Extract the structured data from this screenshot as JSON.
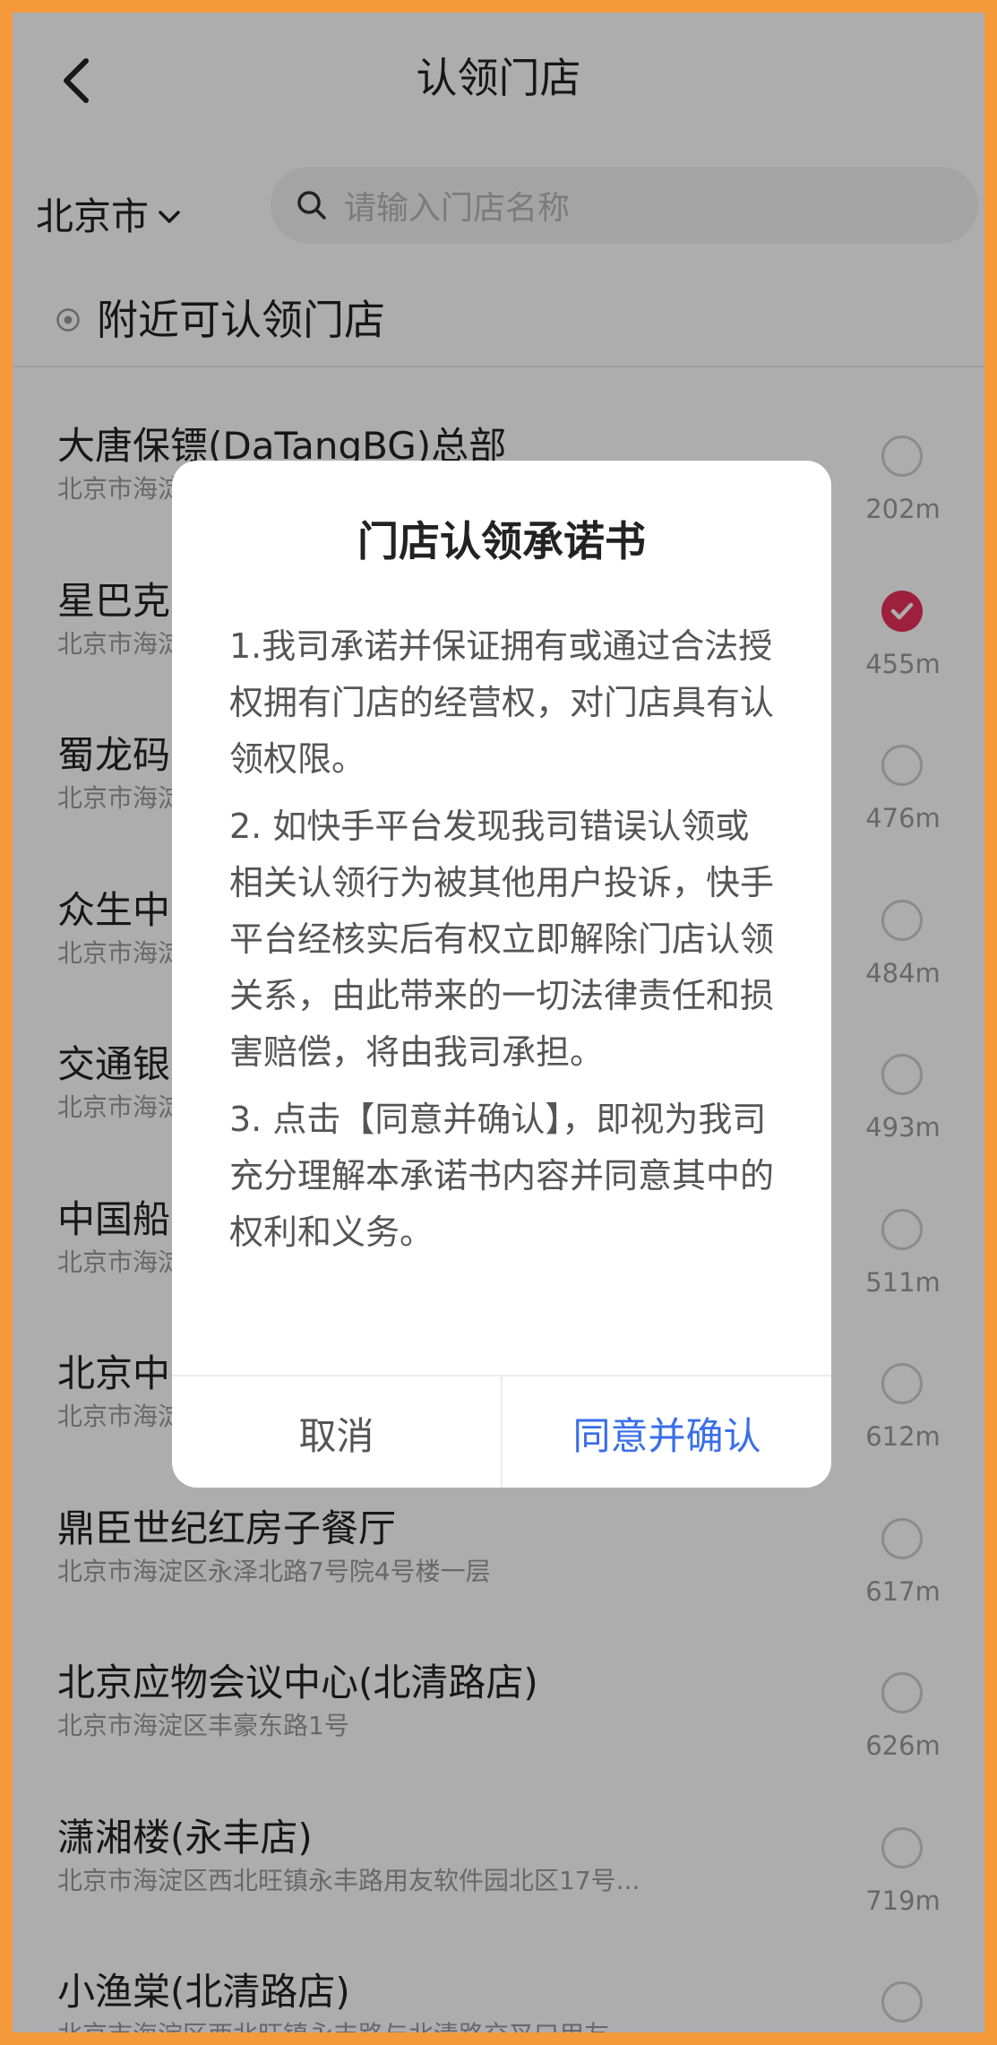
{
  "header": {
    "title": "认领门店"
  },
  "filter": {
    "city": "北京市",
    "search_placeholder": "请输入门店名称"
  },
  "section": {
    "title": "附近可认领门店"
  },
  "stores": [
    {
      "name": "大唐保镖(DaTangBG)总部",
      "address": "北京市海淀区",
      "distance": "202m",
      "selected": false
    },
    {
      "name": "星巴克",
      "address": "北京市海淀区",
      "distance": "455m",
      "selected": true
    },
    {
      "name": "蜀龙码",
      "address": "北京市海淀区",
      "distance": "476m",
      "selected": false
    },
    {
      "name": "众生中",
      "address": "北京市海淀区",
      "distance": "484m",
      "selected": false
    },
    {
      "name": "交通银",
      "address": "北京市海淀区",
      "distance": "493m",
      "selected": false
    },
    {
      "name": "中国船",
      "address": "北京市海淀区",
      "distance": "511m",
      "selected": false
    },
    {
      "name": "北京中",
      "address": "北京市海淀区",
      "distance": "612m",
      "selected": false
    },
    {
      "name": "鼎臣世纪红房子餐厅",
      "address": "北京市海淀区永泽北路7号院4号楼一层",
      "distance": "617m",
      "selected": false
    },
    {
      "name": "北京应物会议中心(北清路店)",
      "address": "北京市海淀区丰豪东路1号",
      "distance": "626m",
      "selected": false
    },
    {
      "name": "潇湘楼(永丰店)",
      "address": "北京市海淀区西北旺镇永丰路用友软件园北区17号...",
      "distance": "719m",
      "selected": false
    },
    {
      "name": "小渔棠(北清路店)",
      "address": "北京市海淀区西北旺镇永丰路与北清路交叉口用友...",
      "distance": "",
      "selected": false
    }
  ],
  "dialog": {
    "title": "门店认领承诺书",
    "terms": [
      "1.我司承诺并保证拥有或通过合法授权拥有门店的经营权，对门店具有认领权限。",
      "2. 如快手平台发现我司错误认领或相关认领行为被其他用户投诉，快手平台经核实后有权立即解除门店认领关系，由此带来的一切法律责任和损害赔偿，将由我司承担。",
      "3. 点击【同意并确认】，即视为我司充分理解本承诺书内容并同意其中的权利和义务。"
    ],
    "cancel_label": "取消",
    "confirm_label": "同意并确认"
  },
  "colors": {
    "accent": "#3a6ee8",
    "selected": "#e8305a",
    "frame": "#f59a3a"
  },
  "icons": {
    "back": "chevron-left-icon",
    "city_dropdown": "chevron-down-icon",
    "search": "search-icon",
    "location": "location-dot-icon",
    "check": "check-icon"
  }
}
